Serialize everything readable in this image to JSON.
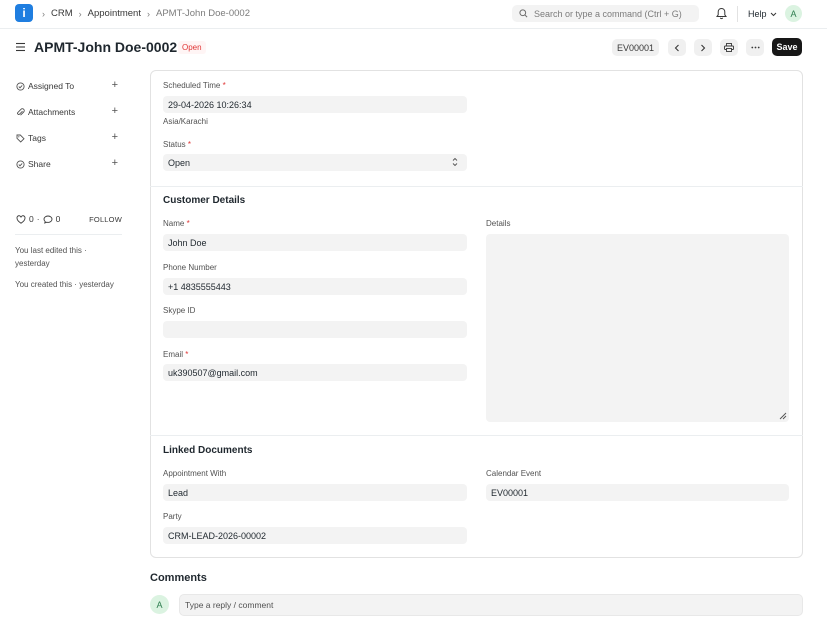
{
  "navbar": {
    "logo_letter": "i",
    "breadcrumbs": [
      "CRM",
      "Appointment",
      "APMT-John Doe-0002"
    ],
    "search_placeholder": "Search or type a command (Ctrl + G)",
    "help_label": "Help",
    "avatar_letter": "A"
  },
  "header": {
    "title": "APMT-John Doe-0002",
    "status": "Open",
    "calendar_event_button": "EV00001",
    "save_label": "Save"
  },
  "sidebar": {
    "items": [
      {
        "label": "Assigned To",
        "icon": "assign-icon"
      },
      {
        "label": "Attachments",
        "icon": "paperclip-icon"
      },
      {
        "label": "Tags",
        "icon": "tag-icon"
      },
      {
        "label": "Share",
        "icon": "share-icon"
      }
    ],
    "likes_count": "0",
    "comments_count": "0",
    "follow_label": "FOLLOW",
    "edited_note": "You last edited this · yesterday",
    "created_note": "You created this · yesterday"
  },
  "form": {
    "scheduled_time": {
      "label": "Scheduled Time",
      "value": "29-04-2026 10:26:34",
      "timezone": "Asia/Karachi"
    },
    "status": {
      "label": "Status",
      "value": "Open"
    },
    "customer_details": {
      "title": "Customer Details",
      "name": {
        "label": "Name",
        "value": "John Doe"
      },
      "phone": {
        "label": "Phone Number",
        "value": "+1 4835555443"
      },
      "skype": {
        "label": "Skype ID",
        "value": ""
      },
      "email": {
        "label": "Email",
        "value": "uk390507@gmail.com"
      },
      "details": {
        "label": "Details"
      }
    },
    "linked_documents": {
      "title": "Linked Documents",
      "appointment_with": {
        "label": "Appointment With",
        "value": "Lead"
      },
      "calendar_event": {
        "label": "Calendar Event",
        "value": "EV00001"
      },
      "party": {
        "label": "Party",
        "value": "CRM-LEAD-2026-00002"
      }
    },
    "required_marker": "*"
  },
  "comments": {
    "title": "Comments",
    "avatar_letter": "A",
    "placeholder": "Type a reply / comment"
  }
}
